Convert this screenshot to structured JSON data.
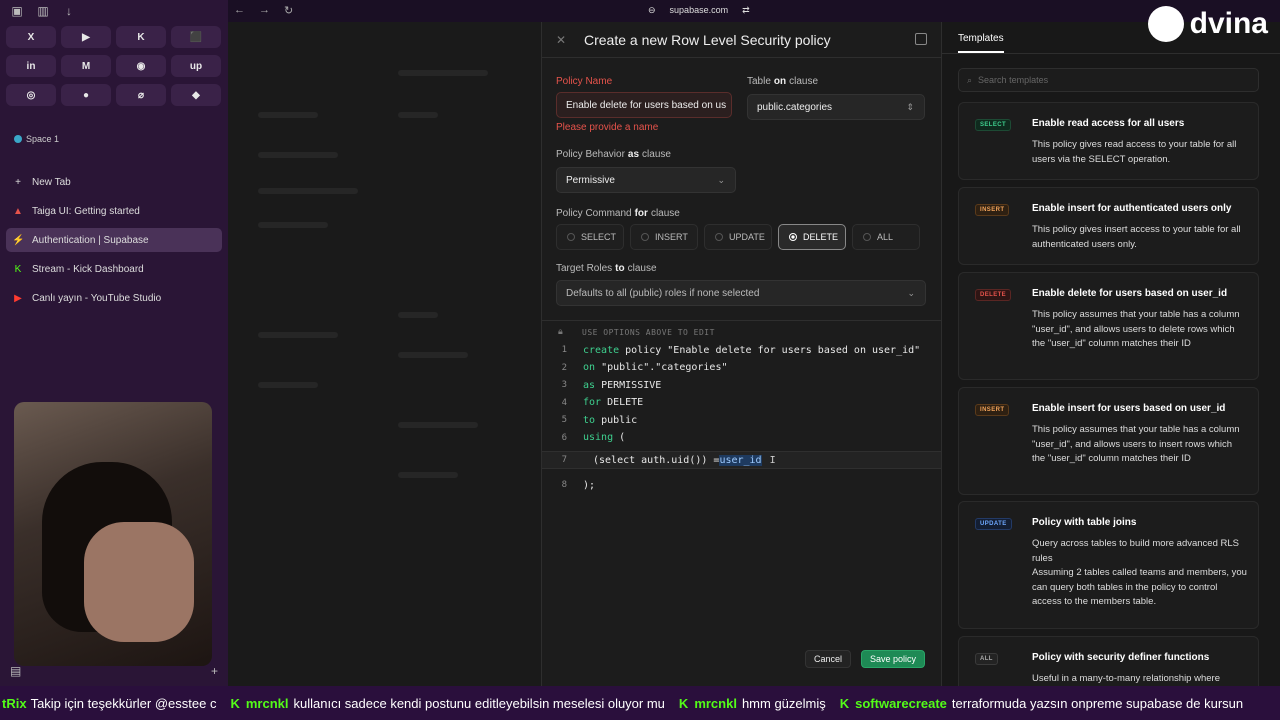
{
  "browser": {
    "url": "supabase.com",
    "favorites": [
      "X",
      "▶",
      "K",
      "⬛",
      "in",
      "M",
      "◉",
      "up",
      "◎",
      "●",
      "⌀",
      "◆"
    ],
    "space_label": "Space 1",
    "new_tab_label": "New Tab",
    "tabs": [
      {
        "icon": "▲",
        "label": "Taiga UI: Getting started",
        "color": "#e5534b"
      },
      {
        "icon": "⚡",
        "label": "Authentication | Supabase",
        "color": "#3ecf8e"
      },
      {
        "icon": "K",
        "label": "Stream - Kick Dashboard",
        "color": "#53fc18"
      },
      {
        "icon": "▶",
        "label": "Canlı yayın - YouTube Studio",
        "color": "#ff3b30"
      }
    ]
  },
  "drawer": {
    "title": "Create a new Row Level Security policy",
    "policy_name_label": "Policy Name",
    "policy_name_value": "Enable delete for users based on us",
    "policy_name_error": "Please provide a name",
    "table_label": "Table",
    "table_kw": "on",
    "table_suffix": "clause",
    "table_value": "public.categories",
    "behavior_label": "Policy Behavior",
    "behavior_kw": "as",
    "behavior_suffix": "clause",
    "behavior_value": "Permissive",
    "command_label": "Policy Command",
    "command_kw": "for",
    "command_suffix": "clause",
    "commands": [
      "SELECT",
      "INSERT",
      "UPDATE",
      "DELETE",
      "ALL"
    ],
    "selected_command": "DELETE",
    "roles_label": "Target Roles",
    "roles_kw": "to",
    "roles_suffix": "clause",
    "roles_value": "Defaults to all (public) roles if none selected",
    "editor_hint": "USE OPTIONS ABOVE TO EDIT",
    "code": [
      {
        "no": "1",
        "kw": "create",
        "rest": " policy \"Enable delete for users based on user_id\""
      },
      {
        "no": "2",
        "kw": "on",
        "rest": " \"public\".\"categories\""
      },
      {
        "no": "3",
        "kw": "as",
        "rest": " PERMISSIVE"
      },
      {
        "no": "4",
        "kw": "for",
        "rest": " DELETE"
      },
      {
        "no": "5",
        "kw": "to",
        "rest": " public"
      },
      {
        "no": "6",
        "kw": "using",
        "rest": " ("
      }
    ],
    "line7_no": "7",
    "line7_text": "(select auth.uid()) = ",
    "line7_highlight": "user_id",
    "line8_no": "8",
    "line8_text": ");",
    "cancel_label": "Cancel",
    "save_label": "Save policy"
  },
  "templates": {
    "tab_label": "Templates",
    "search_placeholder": "Search templates",
    "cards": [
      {
        "badge": "SELECT",
        "title": "Enable read access for all users",
        "desc": "This policy gives read access to your table for all users via the SELECT operation."
      },
      {
        "badge": "INSERT",
        "title": "Enable insert for authenticated users only",
        "desc": "This policy gives insert access to your table for all authenticated users only."
      },
      {
        "badge": "DELETE",
        "title": "Enable delete for users based on user_id",
        "desc": "This policy assumes that your table has a column \"user_id\", and allows users to delete rows which the \"user_id\" column matches their ID"
      },
      {
        "badge": "INSERT",
        "title": "Enable insert for users based on user_id",
        "desc": "This policy assumes that your table has a column \"user_id\", and allows users to insert rows which the \"user_id\" column matches their ID"
      },
      {
        "badge": "UPDATE",
        "title": "Policy with table joins",
        "desc": "Query across tables to build more advanced RLS rules",
        "desc2": "Assuming 2 tables called teams and members, you can query both tables in the policy to control access to the members table."
      },
      {
        "badge": "ALL",
        "title": "Policy with security definer functions",
        "desc": "Useful in a many-to-many relationship where"
      }
    ]
  },
  "overlay": {
    "logo_text": "dvina"
  },
  "ticker": {
    "first_fragment": "tRix",
    "first_message": "Takip için teşekkürler @esstee c",
    "messages": [
      {
        "user": "mrcnkl",
        "text": "kullanıcı sadece kendi postunu editleyebilsin meselesi oluyor mu"
      },
      {
        "user": "mrcnkl",
        "text": "hmm güzelmiş"
      },
      {
        "user": "softwarecreate",
        "text": "terraformuda yazsın onpreme supabase de kursun"
      }
    ]
  },
  "colors": {
    "accent": "#3ecf8e",
    "error": "#e5534b",
    "kick_green": "#53fc18"
  }
}
